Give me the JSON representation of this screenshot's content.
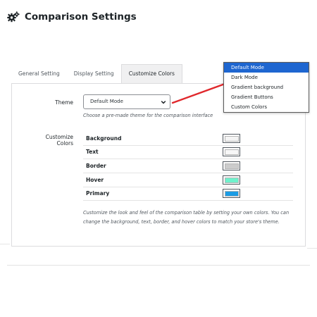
{
  "header": {
    "title": "Comparison Settings",
    "icon": "gears-icon"
  },
  "tabs": [
    {
      "label": "General Setting",
      "active": false
    },
    {
      "label": "Display Setting",
      "active": false
    },
    {
      "label": "Customize Colors",
      "active": true
    }
  ],
  "theme": {
    "label": "Theme",
    "selected": "Default Mode",
    "help": "Choose a pre-made theme for the comparison interface",
    "options": [
      "Default Mode",
      "Dark Mode",
      "Gradient background",
      "Gradient Buttons",
      "Custom Colors"
    ],
    "highlighted_option": "Default Mode"
  },
  "colors": {
    "label": "Customize Colors",
    "items": [
      {
        "name": "Background",
        "color": "#f4f4f4"
      },
      {
        "name": "Text",
        "color": "#f7f7f7"
      },
      {
        "name": "Border",
        "color": "#cccccc"
      },
      {
        "name": "Hover",
        "color": "#6ef2cc"
      },
      {
        "name": "Primary",
        "color": "#1b9ce5"
      }
    ],
    "help": "Customize the look and feel of the comparison table by setting your own colors. You can change the background, text, border, and hover colors to match your store's theme."
  },
  "annotation": {
    "arrow_color": "#e0282c"
  }
}
